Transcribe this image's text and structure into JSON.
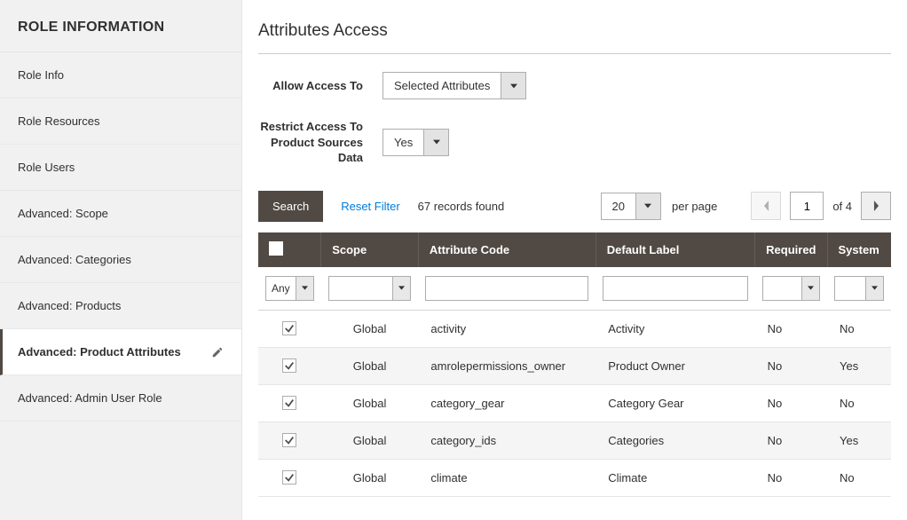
{
  "sidebar": {
    "title": "ROLE INFORMATION",
    "items": [
      {
        "label": "Role Info"
      },
      {
        "label": "Role Resources"
      },
      {
        "label": "Role Users"
      },
      {
        "label": "Advanced: Scope"
      },
      {
        "label": "Advanced: Categories"
      },
      {
        "label": "Advanced: Products"
      },
      {
        "label": "Advanced: Product Attributes"
      },
      {
        "label": "Advanced: Admin User Role"
      }
    ],
    "activeIndex": 6
  },
  "page": {
    "title": "Attributes Access"
  },
  "fields": {
    "allowAccess": {
      "label": "Allow Access To",
      "value": "Selected Attributes"
    },
    "restrict": {
      "label": "Restrict Access To Product Sources Data",
      "value": "Yes"
    }
  },
  "toolbar": {
    "search": "Search",
    "reset": "Reset Filter",
    "recordsFound": "67 records found",
    "pageSize": "20",
    "perPage": "per page",
    "currentPage": "1",
    "ofTotal": "of 4"
  },
  "grid": {
    "headers": {
      "scope": "Scope",
      "code": "Attribute Code",
      "label": "Default Label",
      "required": "Required",
      "system": "System"
    },
    "filters": {
      "any": "Any"
    },
    "rows": [
      {
        "checked": true,
        "scope": "Global",
        "code": "activity",
        "label": "Activity",
        "required": "No",
        "system": "No"
      },
      {
        "checked": true,
        "scope": "Global",
        "code": "amrolepermissions_owner",
        "label": "Product Owner",
        "required": "No",
        "system": "Yes"
      },
      {
        "checked": true,
        "scope": "Global",
        "code": "category_gear",
        "label": "Category Gear",
        "required": "No",
        "system": "No"
      },
      {
        "checked": true,
        "scope": "Global",
        "code": "category_ids",
        "label": "Categories",
        "required": "No",
        "system": "Yes"
      },
      {
        "checked": true,
        "scope": "Global",
        "code": "climate",
        "label": "Climate",
        "required": "No",
        "system": "No"
      }
    ]
  }
}
